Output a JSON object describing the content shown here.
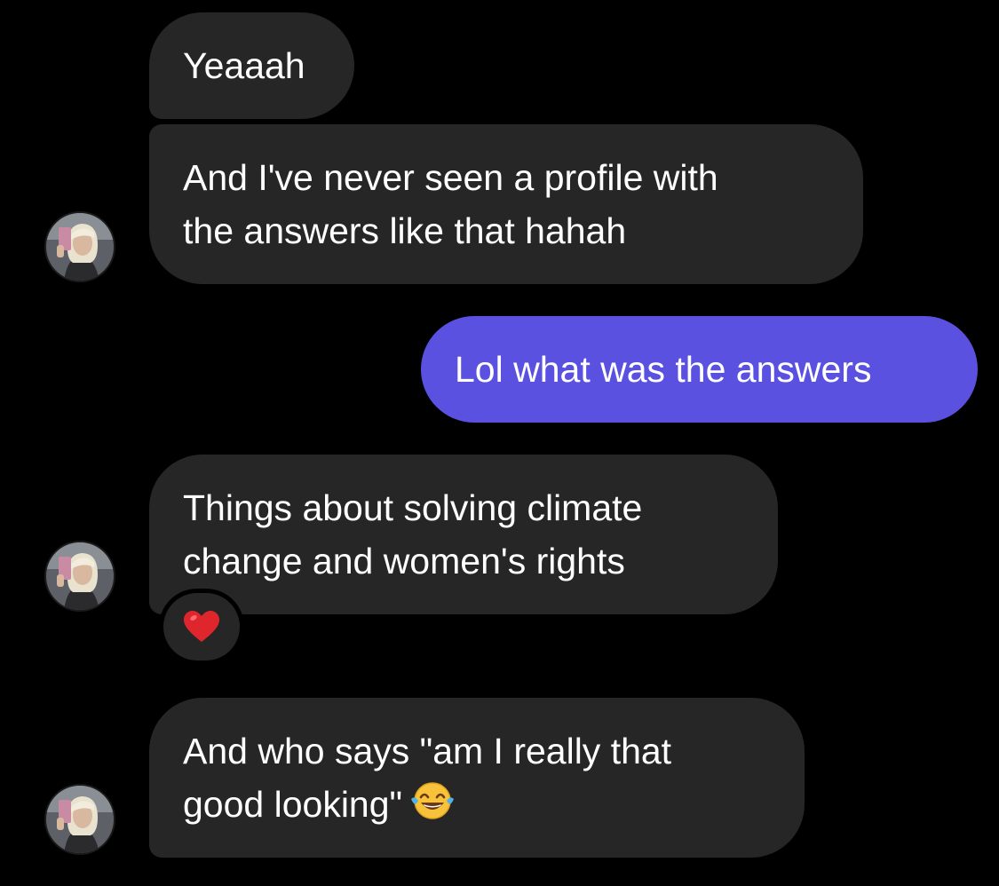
{
  "messages": [
    {
      "direction": "received",
      "lines": [
        "Yeaaah"
      ]
    },
    {
      "direction": "received",
      "lines": [
        "And I've never seen a profile with",
        "the answers like that hahah"
      ]
    },
    {
      "direction": "sent",
      "lines": [
        "Lol what was the answers"
      ]
    },
    {
      "direction": "received",
      "lines": [
        "Things about solving climate",
        "change and women's rights"
      ],
      "reaction": "heart-emoji"
    },
    {
      "direction": "received",
      "lines": [
        "And who says \"am I really that",
        "good looking\""
      ],
      "trailing_emoji": "face-with-tears-of-joy-emoji"
    }
  ],
  "colors": {
    "background": "#000000",
    "received_bubble": "#262626",
    "sent_bubble": "#5b51e0",
    "text": "#ffffff"
  },
  "icons": {
    "avatar": "contact-avatar-photo",
    "reaction": "red-heart-icon",
    "emoji": "face-with-tears-of-joy-icon"
  }
}
